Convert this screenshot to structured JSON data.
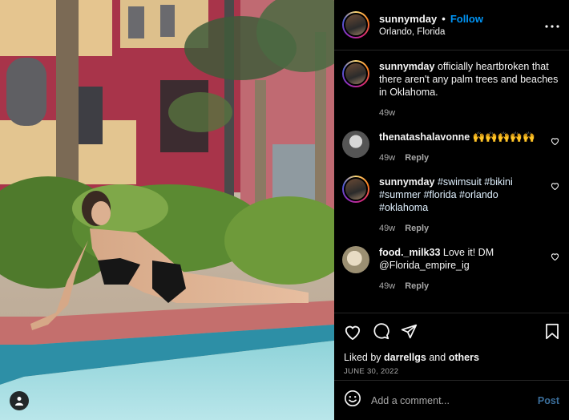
{
  "post": {
    "username": "sunnymday",
    "follow_label": "Follow",
    "separator": "•",
    "location": "Orlando, Florida"
  },
  "comments": [
    {
      "username": "sunnymday",
      "text": "officially heartbroken that there aren't any palm trees and beaches in Oklahoma.",
      "time": "49w",
      "reply": ""
    },
    {
      "username": "thenatashalavonne",
      "text": "🙌🙌🙌🙌🙌",
      "time": "49w",
      "reply": "Reply"
    },
    {
      "username": "sunnymday",
      "text": "#swimsuit #bikini #summer #florida #orlando #oklahoma",
      "time": "49w",
      "reply": "Reply"
    },
    {
      "username": "food._milk33",
      "text": "Love it! DM @Florida_empire_ig",
      "time": "49w",
      "reply": "Reply"
    }
  ],
  "likes": {
    "prefix": "Liked by",
    "user": "darrellgs",
    "conj": "and",
    "others": "others"
  },
  "date": "JUNE 30, 2022",
  "add_comment": {
    "placeholder": "Add a comment...",
    "post_label": "Post"
  },
  "icons": {
    "more": "more-options-icon",
    "heart": "heart-icon",
    "comment": "comment-icon",
    "share": "share-icon",
    "save": "bookmark-icon",
    "emoji": "emoji-icon",
    "tag": "user-tag-icon"
  },
  "colors": {
    "accent": "#0095f6",
    "background": "#000000",
    "muted": "#a8a8a8"
  }
}
